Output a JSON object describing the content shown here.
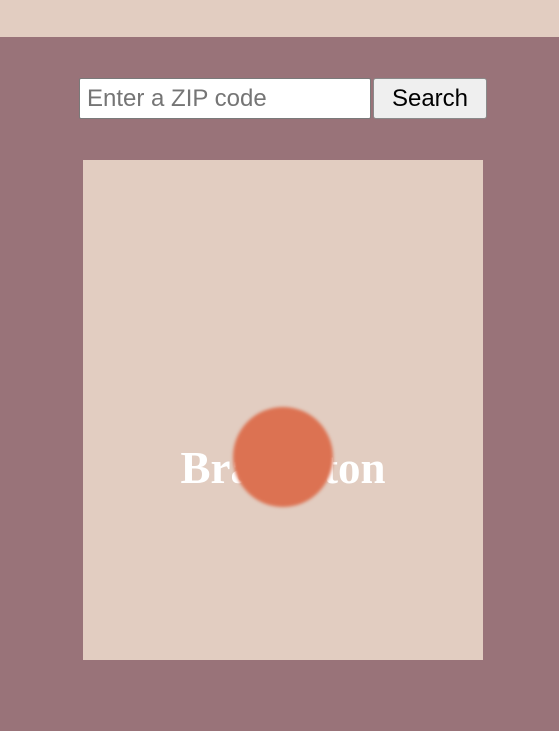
{
  "search": {
    "placeholder": "Enter a ZIP code",
    "value": "",
    "button_label": "Search"
  },
  "card": {
    "city": "Bradenton",
    "indicator_icon": "sun-circle-icon"
  },
  "colors": {
    "page_background": "#997379",
    "band_background": "#e2cdc1",
    "card_background": "#e2cdc1",
    "indicator": "#dc7252",
    "city_text": "#ffffff"
  }
}
